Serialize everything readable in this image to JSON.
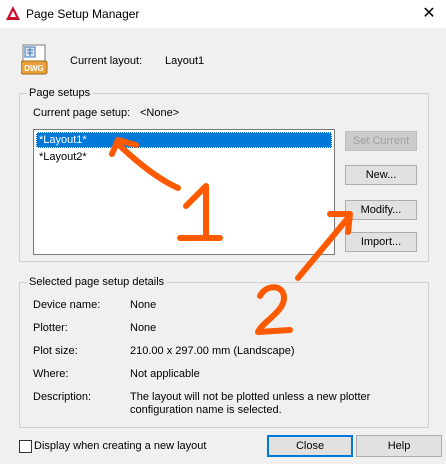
{
  "window": {
    "title": "Page Setup Manager",
    "close_glyph": "✕"
  },
  "header": {
    "icon": "dwg-file-icon",
    "icon_text": "DWG",
    "current_layout_label": "Current layout:",
    "current_layout_value": "Layout1"
  },
  "page_setups": {
    "group_label": "Page setups",
    "current_label": "Current page setup:",
    "current_value": "<None>",
    "items": [
      {
        "label": "*Layout1*",
        "selected": true
      },
      {
        "label": "*Layout2*",
        "selected": false
      }
    ],
    "buttons": {
      "set_current": "Set Current",
      "new": "New...",
      "modify": "Modify...",
      "import": "Import..."
    }
  },
  "details": {
    "group_label": "Selected page setup details",
    "device_name_label": "Device name:",
    "device_name_value": "None",
    "plotter_label": "Plotter:",
    "plotter_value": "None",
    "plot_size_label": "Plot size:",
    "plot_size_value": "210.00 x 297.00 mm (Landscape)",
    "where_label": "Where:",
    "where_value": "Not applicable",
    "description_label": "Description:",
    "description_line1": "The layout will not be plotted unless a new plotter",
    "description_line2": "configuration name is selected."
  },
  "footer": {
    "checkbox_label": "Display when creating a new layout",
    "checkbox_checked": false,
    "close_label": "Close",
    "help_label": "Help"
  },
  "annotations": {
    "color": "#ff5a00",
    "marker1": "1",
    "marker2": "2"
  }
}
